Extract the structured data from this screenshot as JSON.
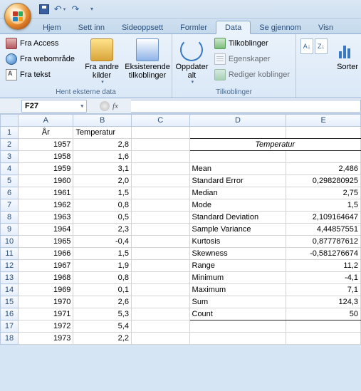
{
  "qat": {
    "undo": "↶",
    "redo": "↷"
  },
  "tabs": [
    "Hjem",
    "Sett inn",
    "Sideoppsett",
    "Formler",
    "Data",
    "Se gjennom",
    "Visn"
  ],
  "active_tab": 4,
  "ribbon": {
    "group1": {
      "label": "Hent eksterne data",
      "access": "Fra Access",
      "web": "Fra webområde",
      "text": "Fra tekst",
      "other": "Fra andre\nkilder",
      "existing": "Eksisterende\ntilkoblinger"
    },
    "group2": {
      "label": "Tilkoblinger",
      "refresh": "Oppdater\nalt",
      "conn": "Tilkoblinger",
      "prop": "Egenskaper",
      "edit": "Rediger koblinger"
    },
    "group3": {
      "sort": "Sorter"
    }
  },
  "namebox": "F27",
  "formula": "",
  "columns": [
    "A",
    "B",
    "C",
    "D",
    "E"
  ],
  "header_row": {
    "A": "År",
    "B": "Temperatur"
  },
  "stats_title": "Temperatur",
  "years": [
    {
      "r": 2,
      "year": "1957",
      "temp": "2,8"
    },
    {
      "r": 3,
      "year": "1958",
      "temp": "1,6"
    },
    {
      "r": 4,
      "year": "1959",
      "temp": "3,1"
    },
    {
      "r": 5,
      "year": "1960",
      "temp": "2,0"
    },
    {
      "r": 6,
      "year": "1961",
      "temp": "1,5"
    },
    {
      "r": 7,
      "year": "1962",
      "temp": "0,8"
    },
    {
      "r": 8,
      "year": "1963",
      "temp": "0,5"
    },
    {
      "r": 9,
      "year": "1964",
      "temp": "2,3"
    },
    {
      "r": 10,
      "year": "1965",
      "temp": "-0,4"
    },
    {
      "r": 11,
      "year": "1966",
      "temp": "1,5"
    },
    {
      "r": 12,
      "year": "1967",
      "temp": "1,9"
    },
    {
      "r": 13,
      "year": "1968",
      "temp": "0,8"
    },
    {
      "r": 14,
      "year": "1969",
      "temp": "0,1"
    },
    {
      "r": 15,
      "year": "1970",
      "temp": "2,6"
    },
    {
      "r": 16,
      "year": "1971",
      "temp": "5,3"
    },
    {
      "r": 17,
      "year": "1972",
      "temp": "5,4"
    },
    {
      "r": 18,
      "year": "1973",
      "temp": "2,2"
    }
  ],
  "stats": [
    {
      "r": 4,
      "label": "Mean",
      "value": "2,486"
    },
    {
      "r": 5,
      "label": "Standard Error",
      "value": "0,298280925"
    },
    {
      "r": 6,
      "label": "Median",
      "value": "2,75"
    },
    {
      "r": 7,
      "label": "Mode",
      "value": "1,5"
    },
    {
      "r": 8,
      "label": "Standard Deviation",
      "value": "2,109164647"
    },
    {
      "r": 9,
      "label": "Sample Variance",
      "value": "4,44857551"
    },
    {
      "r": 10,
      "label": "Kurtosis",
      "value": "0,877787612"
    },
    {
      "r": 11,
      "label": "Skewness",
      "value": "-0,581276674"
    },
    {
      "r": 12,
      "label": "Range",
      "value": "11,2"
    },
    {
      "r": 13,
      "label": "Minimum",
      "value": "-4,1"
    },
    {
      "r": 14,
      "label": "Maximum",
      "value": "7,1"
    },
    {
      "r": 15,
      "label": "Sum",
      "value": "124,3"
    },
    {
      "r": 16,
      "label": "Count",
      "value": "50"
    }
  ]
}
